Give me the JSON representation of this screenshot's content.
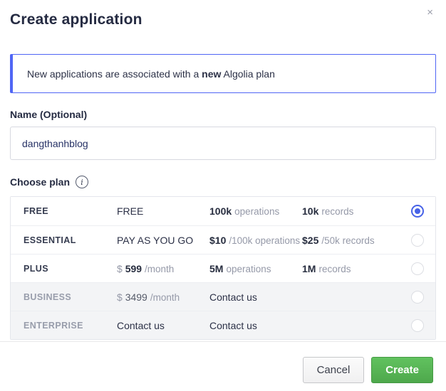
{
  "modal": {
    "title": "Create application",
    "close_icon": "×"
  },
  "notice": {
    "pre": "New applications are associated with a ",
    "bold": "new",
    "post": " Algolia plan"
  },
  "name_field": {
    "label": "Name (Optional)",
    "value": "dangthanhblog"
  },
  "plan_section": {
    "label": "Choose plan",
    "info_icon": "i"
  },
  "plans": [
    {
      "name": "FREE",
      "tier": "FREE",
      "ops_value": "100k",
      "ops_unit": "operations",
      "rec_value": "10k",
      "rec_unit": "records",
      "selected": true
    },
    {
      "name": "ESSENTIAL",
      "tier": "PAY AS YOU GO",
      "ops_value": "$10",
      "ops_unit": "/100k operations",
      "rec_value": "$25",
      "rec_unit": "/50k records",
      "selected": false
    },
    {
      "name": "PLUS",
      "tier_prefix": "$ ",
      "tier_value": "599",
      "tier_suffix": "/month",
      "ops_value": "5M",
      "ops_unit": "operations",
      "rec_value": "1M",
      "rec_unit": "records",
      "selected": false
    },
    {
      "name": "BUSINESS",
      "tier_prefix": "$ ",
      "tier_value": "3499",
      "tier_suffix": "/month",
      "contact": "Contact us",
      "selected": false
    },
    {
      "name": "ENTERPRISE",
      "tier": "Contact us",
      "contact": "Contact us",
      "selected": false
    }
  ],
  "footer": {
    "cancel_label": "Cancel",
    "create_label": "Create"
  },
  "colors": {
    "accent_blue": "#4762e7",
    "notice_border": "#5066f5",
    "button_green": "#55b154"
  }
}
